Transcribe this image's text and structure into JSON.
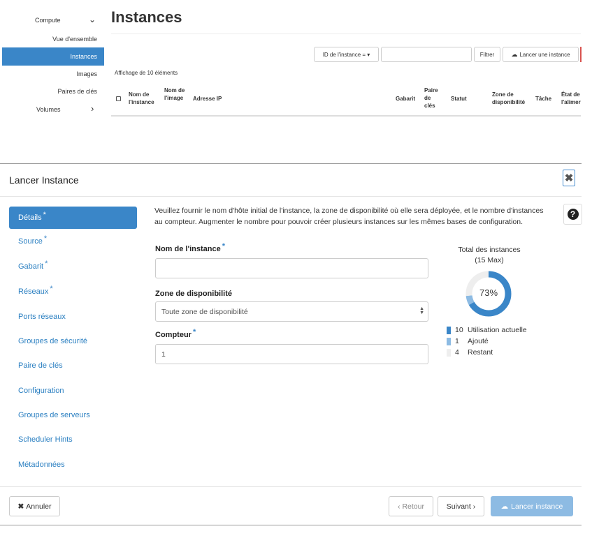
{
  "sidebar": {
    "compute": "Compute",
    "vue": "Vue d'ensemble",
    "instances": "Instances",
    "images": "Images",
    "paires": "Paires de clés",
    "volumes": "Volumes"
  },
  "page": {
    "title": "Instances",
    "filter_select": "ID de l'instance = ▾",
    "filter_button": "Filtrer",
    "launch_button": "Lancer une instance",
    "affichage": "Affichage de 10 éléments",
    "columns": {
      "nom_instance": "Nom de l'instance",
      "nom_image": "Nom de l'image",
      "adresse_ip": "Adresse IP",
      "gabarit": "Gabarit",
      "paire": "Paire de clés",
      "statut": "Statut",
      "zone": "Zone de disponibilité",
      "tache": "Tâche",
      "etat": "État de l'alimer"
    }
  },
  "modal": {
    "title": "Lancer Instance",
    "nav": {
      "details": "Détails",
      "source": "Source",
      "gabarit": "Gabarit",
      "reseaux": "Réseaux",
      "ports": "Ports réseaux",
      "groupes_securite": "Groupes de sécurité",
      "paire": "Paire de clés",
      "configuration": "Configuration",
      "groupes_serveurs": "Groupes de serveurs",
      "scheduler": "Scheduler Hints",
      "metadonnees": "Métadonnées"
    },
    "required_mark": "*",
    "intro": "Veuillez fournir le nom d'hôte initial de l'instance, la zone de disponibilité où elle sera déployée, et le nombre d'instances au compteur. Augmenter le nombre pour pouvoir créer plusieurs instances sur les mêmes bases de configuration.",
    "form": {
      "nom_label": "Nom de l'instance",
      "nom_value": "",
      "zone_label": "Zone de disponibilité",
      "zone_value": "Toute zone de disponibilité",
      "compteur_label": "Compteur",
      "compteur_value": "1"
    },
    "quota": {
      "title": "Total des instances",
      "max": "(15 Max)",
      "percent_label": "73%",
      "used": 10,
      "added": 1,
      "remaining": 4,
      "total": 15,
      "legend": [
        {
          "num": "10",
          "label": "Utilisation actuelle",
          "color": "#3a86c8"
        },
        {
          "num": "1",
          "label": "Ajouté",
          "color": "#8dbbe3"
        },
        {
          "num": "4",
          "label": "Restant",
          "color": "#eeeeee"
        }
      ]
    },
    "buttons": {
      "cancel": "Annuler",
      "back": "‹ Retour",
      "next": "Suivant ›",
      "launch": "Lancer instance"
    }
  },
  "colors": {
    "accent": "#3a86c8",
    "accent_light": "#8dbbe3"
  }
}
